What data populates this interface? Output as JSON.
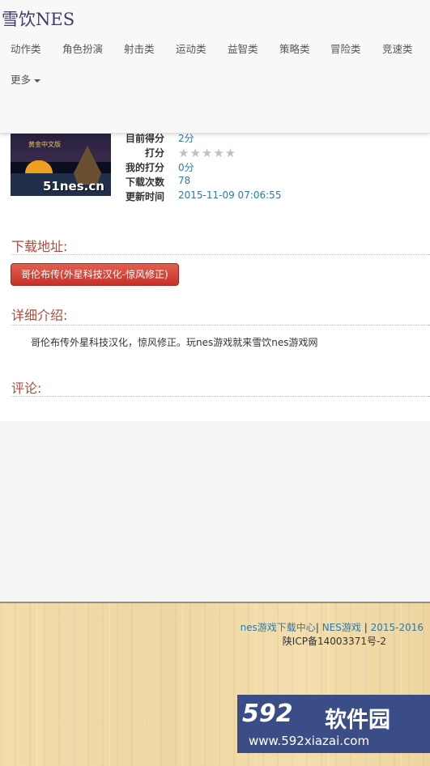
{
  "header": {
    "brand": "雪饮NES",
    "nav": [
      "动作类",
      "角色扮演",
      "射击类",
      "运动类",
      "益智类",
      "策略类",
      "冒险类",
      "竞速类"
    ],
    "more": "更多"
  },
  "game": {
    "thumbnail_subtitle": "黄金中文版",
    "thumbnail_watermark": "51nes.cn",
    "labels": {
      "score": "目前得分",
      "rate": "打分",
      "my_rating": "我的打分",
      "downloads": "下载次数",
      "updated": "更新时间"
    },
    "values": {
      "score": "2分",
      "my_rating": "0分",
      "downloads": "78",
      "updated": "2015-11-09 07:06:55"
    },
    "stars": "★★★★★",
    "star_rating": 0
  },
  "download": {
    "title": "下载地址:",
    "button": "哥伦布传(外星科技汉化-惊风修正)"
  },
  "details": {
    "title": "详细介绍:",
    "text": "哥伦布传外星科技汉化，惊风修正。玩nes游戏就来雪饮nes游戏网"
  },
  "comments": {
    "title": "评论:"
  },
  "footer": {
    "link1": "nes游戏下载中心",
    "sep1": "|",
    "link2": "NES游戏",
    "sep2": "|",
    "years": "2015-2016",
    "icp": "陕ICP备14003371号-2"
  },
  "watermark": {
    "number": "592",
    "name": "软件园",
    "url": "www.592xiazai.com"
  },
  "colors": {
    "section_title": "#b04a3a",
    "link": "#2a7ab0",
    "button": "#c8302a"
  }
}
